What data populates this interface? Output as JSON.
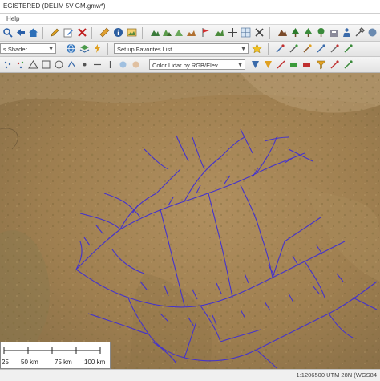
{
  "window": {
    "title": "EGISTERED (DELIM 5V GM.gmw*)"
  },
  "menu": {
    "items": [
      "Help"
    ]
  },
  "toolbar": {
    "shader_select": "s Shader",
    "favorites_select": "Set up Favorites List...",
    "lidar_select": "Color Lidar by RGB/Elev"
  },
  "colors": {
    "drainage": "#4433cc",
    "terrain_base": "#a98a5a"
  },
  "scale_bar": {
    "labels": [
      "50 km",
      "75 km",
      "100 km"
    ],
    "level": "25"
  },
  "status_bar": {
    "projection_text": "1:1206500  UTM 28N (WGS84"
  },
  "icons": [
    "search-icon",
    "back-arrow-icon",
    "home-icon",
    "pencil-icon",
    "edit-icon",
    "close-icon",
    "ruler-icon",
    "info-icon",
    "image-icon",
    "terrain-icon",
    "globe-icon",
    "star-icon",
    "wrench-icon"
  ]
}
